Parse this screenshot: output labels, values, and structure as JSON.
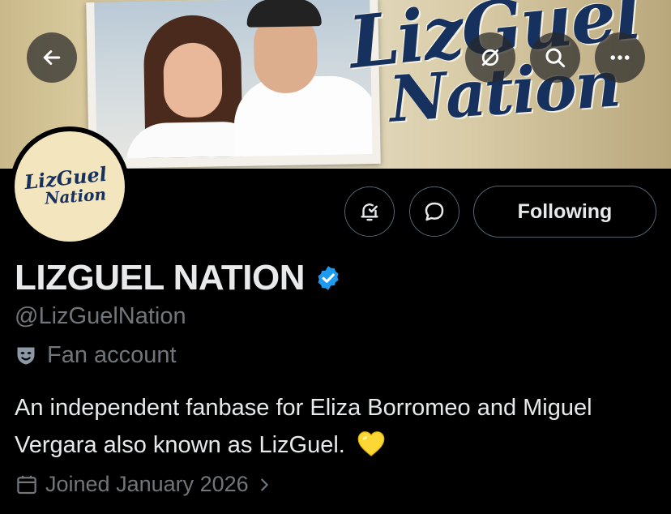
{
  "banner": {
    "logo_line1": "LizGuel",
    "logo_line2": "Nation"
  },
  "avatar": {
    "logo_line1": "LizGuel",
    "logo_line2": "Nation"
  },
  "header_actions": {
    "back_icon": "arrow-left-icon",
    "grok_icon": "grok-icon",
    "search_icon": "search-icon",
    "more_icon": "more-icon"
  },
  "profile_actions": {
    "notifications_icon": "bell-check-icon",
    "message_icon": "message-bubble-icon",
    "following_label": "Following"
  },
  "profile": {
    "display_name": "LIZGUEL NATION",
    "handle": "@LizGuelNation",
    "category": "Fan account",
    "bio": "An independent fanbase for Eliza Borromeo and Miguel Vergara also known as LizGuel.",
    "bio_emoji": "yellow-heart-icon",
    "joined": "Joined January 2026"
  },
  "colors": {
    "background": "#000000",
    "text_primary": "#e7e9ea",
    "text_secondary": "#71767b",
    "verified": "#1d9bf0",
    "border": "#536471"
  }
}
